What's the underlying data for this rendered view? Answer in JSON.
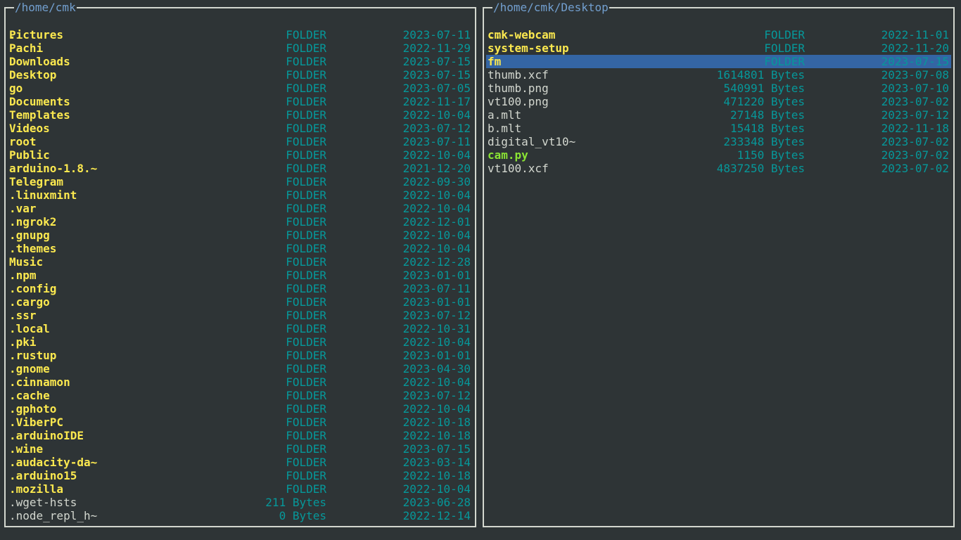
{
  "left_panel": {
    "path": "/home/cmk",
    "up_entry": "..",
    "entries": [
      {
        "name": "Pictures",
        "size": "FOLDER",
        "date": "2023-07-11",
        "type": "folder"
      },
      {
        "name": "Pachi",
        "size": "FOLDER",
        "date": "2022-11-29",
        "type": "folder"
      },
      {
        "name": "Downloads",
        "size": "FOLDER",
        "date": "2023-07-15",
        "type": "folder"
      },
      {
        "name": "Desktop",
        "size": "FOLDER",
        "date": "2023-07-15",
        "type": "folder"
      },
      {
        "name": "go",
        "size": "FOLDER",
        "date": "2023-07-05",
        "type": "folder"
      },
      {
        "name": "Documents",
        "size": "FOLDER",
        "date": "2022-11-17",
        "type": "folder"
      },
      {
        "name": "Templates",
        "size": "FOLDER",
        "date": "2022-10-04",
        "type": "folder"
      },
      {
        "name": "Videos",
        "size": "FOLDER",
        "date": "2023-07-12",
        "type": "folder"
      },
      {
        "name": "root",
        "size": "FOLDER",
        "date": "2023-07-11",
        "type": "folder"
      },
      {
        "name": "Public",
        "size": "FOLDER",
        "date": "2022-10-04",
        "type": "folder"
      },
      {
        "name": "arduino-1.8.~",
        "size": "FOLDER",
        "date": "2021-12-20",
        "type": "folder"
      },
      {
        "name": "Telegram",
        "size": "FOLDER",
        "date": "2022-09-30",
        "type": "folder"
      },
      {
        "name": ".linuxmint",
        "size": "FOLDER",
        "date": "2022-10-04",
        "type": "folder"
      },
      {
        "name": ".var",
        "size": "FOLDER",
        "date": "2022-10-04",
        "type": "folder"
      },
      {
        "name": ".ngrok2",
        "size": "FOLDER",
        "date": "2022-12-01",
        "type": "folder"
      },
      {
        "name": ".gnupg",
        "size": "FOLDER",
        "date": "2022-10-04",
        "type": "folder"
      },
      {
        "name": ".themes",
        "size": "FOLDER",
        "date": "2022-10-04",
        "type": "folder"
      },
      {
        "name": "Music",
        "size": "FOLDER",
        "date": "2022-12-28",
        "type": "folder"
      },
      {
        "name": ".npm",
        "size": "FOLDER",
        "date": "2023-01-01",
        "type": "folder"
      },
      {
        "name": ".config",
        "size": "FOLDER",
        "date": "2023-07-11",
        "type": "folder"
      },
      {
        "name": ".cargo",
        "size": "FOLDER",
        "date": "2023-01-01",
        "type": "folder"
      },
      {
        "name": ".ssr",
        "size": "FOLDER",
        "date": "2023-07-12",
        "type": "folder"
      },
      {
        "name": ".local",
        "size": "FOLDER",
        "date": "2022-10-31",
        "type": "folder"
      },
      {
        "name": ".pki",
        "size": "FOLDER",
        "date": "2022-10-04",
        "type": "folder"
      },
      {
        "name": ".rustup",
        "size": "FOLDER",
        "date": "2023-01-01",
        "type": "folder"
      },
      {
        "name": ".gnome",
        "size": "FOLDER",
        "date": "2023-04-30",
        "type": "folder"
      },
      {
        "name": ".cinnamon",
        "size": "FOLDER",
        "date": "2022-10-04",
        "type": "folder"
      },
      {
        "name": ".cache",
        "size": "FOLDER",
        "date": "2023-07-12",
        "type": "folder"
      },
      {
        "name": ".gphoto",
        "size": "FOLDER",
        "date": "2022-10-04",
        "type": "folder"
      },
      {
        "name": ".ViberPC",
        "size": "FOLDER",
        "date": "2022-10-18",
        "type": "folder"
      },
      {
        "name": ".arduinoIDE",
        "size": "FOLDER",
        "date": "2022-10-18",
        "type": "folder"
      },
      {
        "name": ".wine",
        "size": "FOLDER",
        "date": "2023-07-15",
        "type": "folder"
      },
      {
        "name": ".audacity-da~",
        "size": "FOLDER",
        "date": "2023-03-14",
        "type": "folder"
      },
      {
        "name": ".arduino15",
        "size": "FOLDER",
        "date": "2022-10-18",
        "type": "folder"
      },
      {
        "name": ".mozilla",
        "size": "FOLDER",
        "date": "2022-10-04",
        "type": "folder"
      },
      {
        "name": ".wget-hsts",
        "size": "211 Bytes",
        "date": "2023-06-28",
        "type": "file"
      },
      {
        "name": ".node_repl_h~",
        "size": "0 Bytes",
        "date": "2022-12-14",
        "type": "file"
      }
    ]
  },
  "right_panel": {
    "path": "/home/cmk/Desktop",
    "up_entry": "..",
    "selected_index": 2,
    "entries": [
      {
        "name": "cmk-webcam",
        "size": "FOLDER",
        "date": "2022-11-01",
        "type": "folder"
      },
      {
        "name": "system-setup",
        "size": "FOLDER",
        "date": "2022-11-20",
        "type": "folder"
      },
      {
        "name": "fm",
        "size": "FOLDER",
        "date": "2023-07-15",
        "type": "folder"
      },
      {
        "name": "thumb.xcf",
        "size": "1614801 Bytes",
        "date": "2023-07-08",
        "type": "file"
      },
      {
        "name": "thumb.png",
        "size": "540991 Bytes",
        "date": "2023-07-10",
        "type": "file"
      },
      {
        "name": "vt100.png",
        "size": "471220 Bytes",
        "date": "2023-07-02",
        "type": "file"
      },
      {
        "name": "a.mlt",
        "size": "27148 Bytes",
        "date": "2023-07-12",
        "type": "file"
      },
      {
        "name": "b.mlt",
        "size": "15418 Bytes",
        "date": "2022-11-18",
        "type": "file"
      },
      {
        "name": "digital_vt10~",
        "size": "233348 Bytes",
        "date": "2023-07-02",
        "type": "file"
      },
      {
        "name": "cam.py",
        "size": "1150 Bytes",
        "date": "2023-07-02",
        "type": "exec"
      },
      {
        "name": "vt100.xcf",
        "size": "4837250 Bytes",
        "date": "2023-07-02",
        "type": "file"
      }
    ]
  },
  "colors": {
    "background": "#2e3436",
    "border": "#d3d7cf",
    "path_title": "#729fcf",
    "folder_name": "#fce94f",
    "file_name": "#d3d7cf",
    "exec_name": "#8ae234",
    "meta": "#06989a",
    "selection": "#3465a4"
  }
}
